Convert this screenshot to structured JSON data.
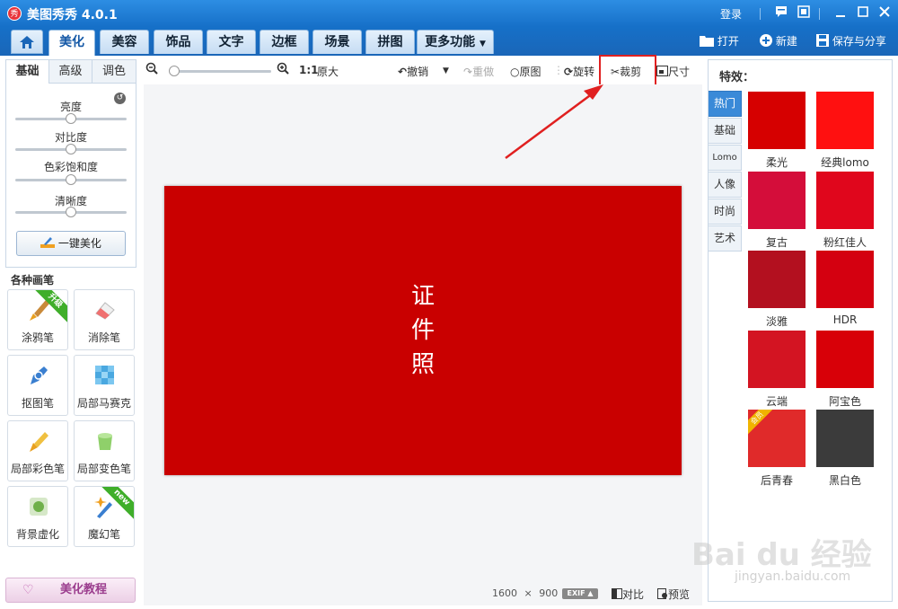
{
  "window": {
    "logo_text": "秀",
    "title": "美图秀秀 4.0.1",
    "login": "登录"
  },
  "tabs": [
    {
      "label": "美化",
      "active": true
    },
    {
      "label": "美容",
      "active": false
    },
    {
      "label": "饰品",
      "active": false
    },
    {
      "label": "文字",
      "active": false
    },
    {
      "label": "边框",
      "active": false
    },
    {
      "label": "场景",
      "active": false
    },
    {
      "label": "拼图",
      "active": false
    },
    {
      "label": "更多功能",
      "active": false
    }
  ],
  "actions": {
    "open": "打开",
    "new": "新建",
    "save_share": "保存与分享"
  },
  "left_panel": {
    "subtabs": [
      "基础",
      "高级",
      "调色"
    ],
    "sliders": [
      {
        "label": "亮度",
        "value": 0.5
      },
      {
        "label": "对比度",
        "value": 0.5
      },
      {
        "label": "色彩饱和度",
        "value": 0.5
      },
      {
        "label": "清晰度",
        "value": 0.5
      }
    ],
    "one_click": "一键美化"
  },
  "brushes": {
    "title": "各种画笔",
    "items": [
      {
        "label": "涂鸦笔",
        "icon": "paintbrush-icon",
        "ribbon": "升级"
      },
      {
        "label": "消除笔",
        "icon": "eraser-icon"
      },
      {
        "label": "抠图笔",
        "icon": "pen-icon"
      },
      {
        "label": "局部马赛克",
        "icon": "mosaic-icon"
      },
      {
        "label": "局部彩色笔",
        "icon": "color-brush-icon"
      },
      {
        "label": "局部变色笔",
        "icon": "paint-bucket-icon"
      },
      {
        "label": "背景虚化",
        "icon": "blur-icon"
      },
      {
        "label": "魔幻笔",
        "icon": "magic-wand-icon",
        "ribbon": "new"
      }
    ],
    "tutorial": "美化教程"
  },
  "toolbar": {
    "ratio": "1:1",
    "original_size": "原大",
    "undo": "撤销",
    "redo": "重做",
    "original": "原图",
    "rotate": "旋转",
    "crop": "裁剪",
    "resize": "尺寸",
    "zoom": 0.05
  },
  "canvas": {
    "photo_text": "证件照",
    "photo_color": "#c90000",
    "width": "1600",
    "height": "900",
    "dims_sep": "×",
    "exif": "EXIF",
    "compare": "对比",
    "preview": "预览"
  },
  "effects": {
    "title": "特效：",
    "categories": [
      {
        "label": "热门",
        "active": true
      },
      {
        "label": "基础",
        "active": false
      },
      {
        "label": "Lomo",
        "active": false
      },
      {
        "label": "人像",
        "active": false
      },
      {
        "label": "时尚",
        "active": false
      },
      {
        "label": "艺术",
        "active": false
      }
    ],
    "items": [
      {
        "label": "柔光",
        "color": "#d60000"
      },
      {
        "label": "经典lomo",
        "color": "#ff1010"
      },
      {
        "label": "复古",
        "color": "#d40d3a"
      },
      {
        "label": "粉红佳人",
        "color": "#e0061c"
      },
      {
        "label": "淡雅",
        "color": "#b3101f"
      },
      {
        "label": "HDR",
        "color": "#d40010"
      },
      {
        "label": "云端",
        "color": "#d31422"
      },
      {
        "label": "阿宝色",
        "color": "#d80008"
      },
      {
        "label": "后青春",
        "color": "#e02a2a",
        "badge": "会员"
      },
      {
        "label": "黑白色",
        "color": "#3b3b3b"
      }
    ]
  },
  "annotation": {
    "color": "#e02020"
  },
  "watermark": {
    "text": "Bai du 经验",
    "url": "jingyan.baidu.com"
  }
}
